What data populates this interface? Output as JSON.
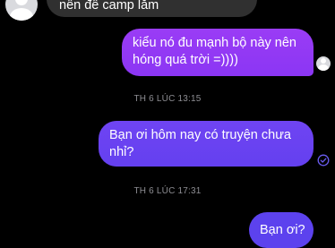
{
  "conversation": {
    "messages": [
      {
        "sender": "other",
        "text": "nên đế camp lắm"
      },
      {
        "sender": "me",
        "text": "kiểu nó đu mạnh bộ này nên hóng quá trời =))))"
      },
      {
        "sender": "me",
        "text": "Bạn ơi hôm nay có truyện chưa nhỉ?"
      },
      {
        "sender": "me",
        "text": "Bạn ơi?"
      }
    ],
    "timestamps": [
      "TH 6 LÚC 13:15",
      "TH 6 LÚC 17:31"
    ]
  },
  "colors": {
    "background": "#000000",
    "incoming_bubble": "#303030",
    "outgoing_gradient_top": "#9a3cf5",
    "outgoing_gradient_bottom": "#5c42ee",
    "timestamp": "#8e8e93"
  },
  "icons": {
    "contact_avatar": "avatar-placeholder-icon",
    "read_receipt": "seen-avatar-icon",
    "delivery_status": "check-circle-icon"
  }
}
